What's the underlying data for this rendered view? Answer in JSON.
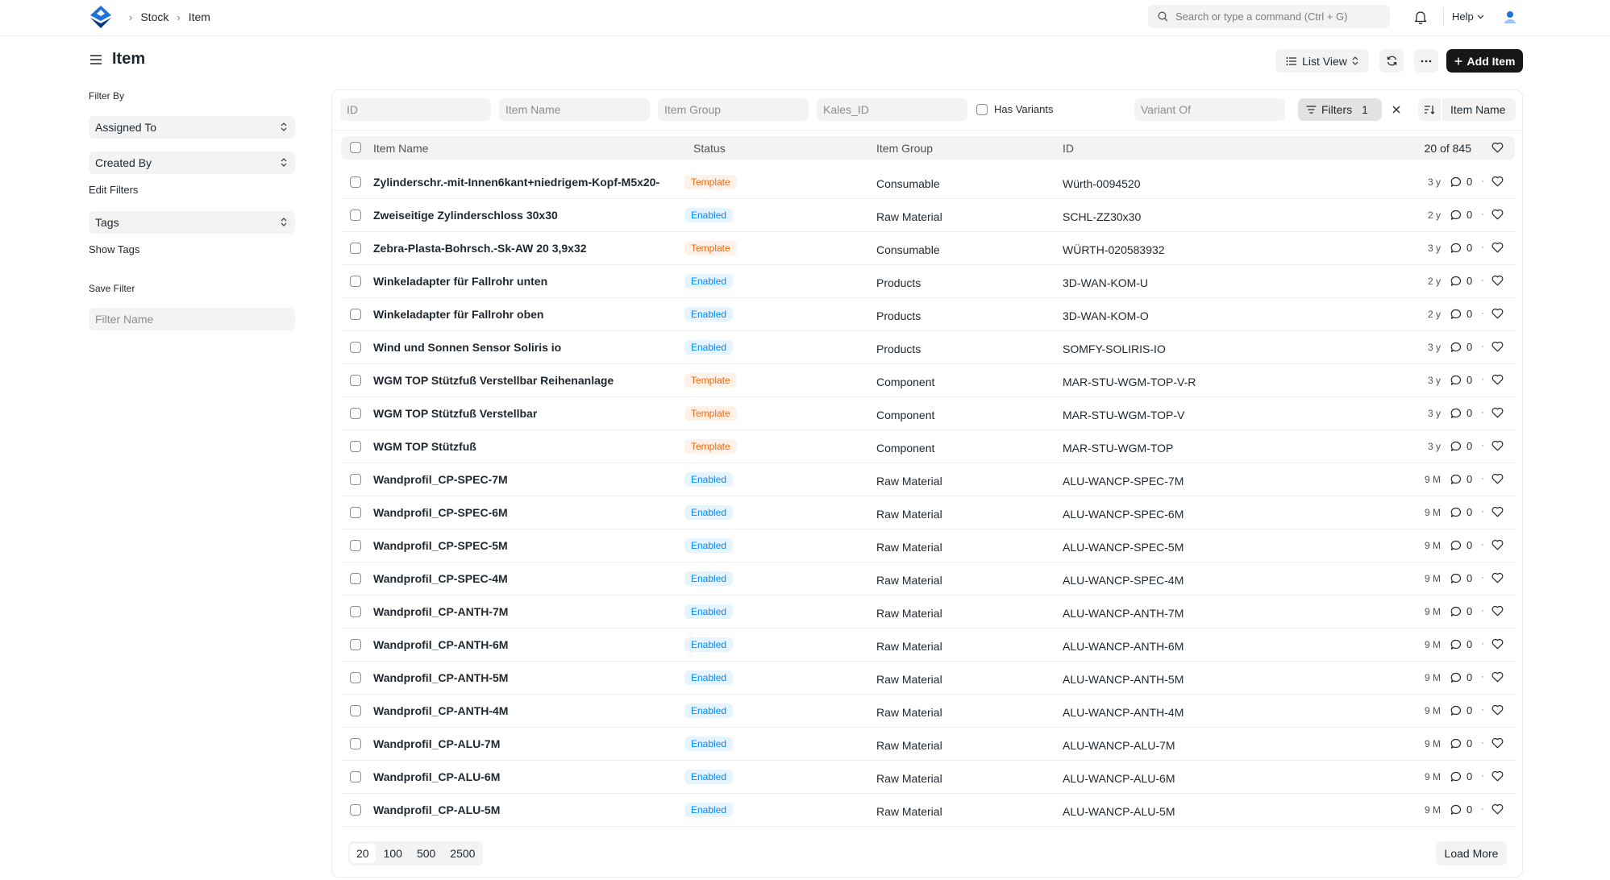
{
  "breadcrumb": [
    "Stock",
    "Item"
  ],
  "search": {
    "placeholder": "Search or type a command (Ctrl + G)"
  },
  "navbar": {
    "help_label": "Help"
  },
  "page": {
    "title": "Item",
    "list_view_label": "List View",
    "add_label": "Add Item"
  },
  "sidebar": {
    "filter_by_label": "Filter By",
    "assigned_to": "Assigned To",
    "created_by": "Created By",
    "edit_filters": "Edit Filters",
    "tags": "Tags",
    "show_tags": "Show Tags",
    "save_filter_label": "Save Filter",
    "filter_name_placeholder": "Filter Name"
  },
  "filters": {
    "id_placeholder": "ID",
    "item_name_placeholder": "Item Name",
    "item_group_placeholder": "Item Group",
    "kales_id_placeholder": "Kales_ID",
    "has_variants_label": "Has Variants",
    "variant_of_placeholder": "Variant Of",
    "filters_label": "Filters",
    "filters_count": "1",
    "sort_field": "Item Name"
  },
  "table": {
    "columns": {
      "name": "Item Name",
      "status": "Status",
      "group": "Item Group",
      "id": "ID"
    },
    "count_label": "20 of 845",
    "rows": [
      {
        "name": "Zylinderschr.-mit-Innen6kant+niedrigem-Kopf-M5x20-",
        "status": "Template",
        "group": "Consumable",
        "id": "Würth-0094520",
        "modified": "3 y",
        "comments": "0"
      },
      {
        "name": "Zweiseitige Zylinderschloss 30x30",
        "status": "Enabled",
        "group": "Raw Material",
        "id": "SCHL-ZZ30x30",
        "modified": "2 y",
        "comments": "0"
      },
      {
        "name": "Zebra-Plasta-Bohrsch.-Sk-AW 20 3,9x32",
        "status": "Template",
        "group": "Consumable",
        "id": "WÜRTH-020583932",
        "modified": "3 y",
        "comments": "0"
      },
      {
        "name": "Winkeladapter für Fallrohr unten",
        "status": "Enabled",
        "group": "Products",
        "id": "3D-WAN-KOM-U",
        "modified": "2 y",
        "comments": "0"
      },
      {
        "name": "Winkeladapter für Fallrohr oben",
        "status": "Enabled",
        "group": "Products",
        "id": "3D-WAN-KOM-O",
        "modified": "2 y",
        "comments": "0"
      },
      {
        "name": "Wind und Sonnen Sensor Soliris io",
        "status": "Enabled",
        "group": "Products",
        "id": "SOMFY-SOLIRIS-IO",
        "modified": "3 y",
        "comments": "0"
      },
      {
        "name": "WGM TOP Stützfuß Verstellbar Reihenanlage",
        "status": "Template",
        "group": "Component",
        "id": "MAR-STU-WGM-TOP-V-R",
        "modified": "3 y",
        "comments": "0"
      },
      {
        "name": "WGM TOP Stützfuß Verstellbar",
        "status": "Template",
        "group": "Component",
        "id": "MAR-STU-WGM-TOP-V",
        "modified": "3 y",
        "comments": "0"
      },
      {
        "name": "WGM TOP Stützfuß",
        "status": "Template",
        "group": "Component",
        "id": "MAR-STU-WGM-TOP",
        "modified": "3 y",
        "comments": "0"
      },
      {
        "name": "Wandprofil_CP-SPEC-7M",
        "status": "Enabled",
        "group": "Raw Material",
        "id": "ALU-WANCP-SPEC-7M",
        "modified": "9 M",
        "comments": "0"
      },
      {
        "name": "Wandprofil_CP-SPEC-6M",
        "status": "Enabled",
        "group": "Raw Material",
        "id": "ALU-WANCP-SPEC-6M",
        "modified": "9 M",
        "comments": "0"
      },
      {
        "name": "Wandprofil_CP-SPEC-5M",
        "status": "Enabled",
        "group": "Raw Material",
        "id": "ALU-WANCP-SPEC-5M",
        "modified": "9 M",
        "comments": "0"
      },
      {
        "name": "Wandprofil_CP-SPEC-4M",
        "status": "Enabled",
        "group": "Raw Material",
        "id": "ALU-WANCP-SPEC-4M",
        "modified": "9 M",
        "comments": "0"
      },
      {
        "name": "Wandprofil_CP-ANTH-7M",
        "status": "Enabled",
        "group": "Raw Material",
        "id": "ALU-WANCP-ANTH-7M",
        "modified": "9 M",
        "comments": "0"
      },
      {
        "name": "Wandprofil_CP-ANTH-6M",
        "status": "Enabled",
        "group": "Raw Material",
        "id": "ALU-WANCP-ANTH-6M",
        "modified": "9 M",
        "comments": "0"
      },
      {
        "name": "Wandprofil_CP-ANTH-5M",
        "status": "Enabled",
        "group": "Raw Material",
        "id": "ALU-WANCP-ANTH-5M",
        "modified": "9 M",
        "comments": "0"
      },
      {
        "name": "Wandprofil_CP-ANTH-4M",
        "status": "Enabled",
        "group": "Raw Material",
        "id": "ALU-WANCP-ANTH-4M",
        "modified": "9 M",
        "comments": "0"
      },
      {
        "name": "Wandprofil_CP-ALU-7M",
        "status": "Enabled",
        "group": "Raw Material",
        "id": "ALU-WANCP-ALU-7M",
        "modified": "9 M",
        "comments": "0"
      },
      {
        "name": "Wandprofil_CP-ALU-6M",
        "status": "Enabled",
        "group": "Raw Material",
        "id": "ALU-WANCP-ALU-6M",
        "modified": "9 M",
        "comments": "0"
      },
      {
        "name": "Wandprofil_CP-ALU-5M",
        "status": "Enabled",
        "group": "Raw Material",
        "id": "ALU-WANCP-ALU-5M",
        "modified": "9 M",
        "comments": "0"
      }
    ]
  },
  "footer": {
    "page_sizes": [
      "20",
      "100",
      "500",
      "2500"
    ],
    "active_page_size": "20",
    "load_more_label": "Load More"
  },
  "colors": {
    "status_enabled": "#0289f7",
    "status_template": "#e86c13",
    "primary_button": "#171717",
    "logo": "#1e73d6"
  }
}
